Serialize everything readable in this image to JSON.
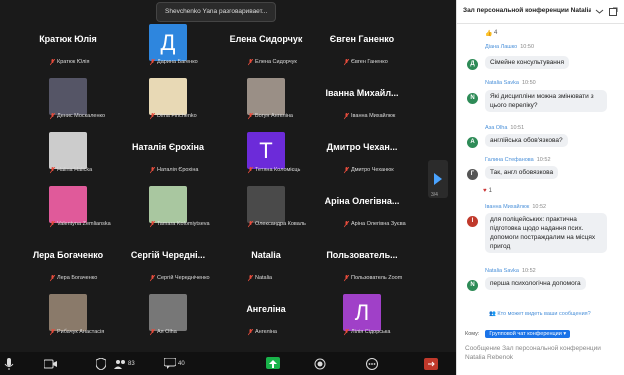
{
  "toast": "Shevchenko Yana разговаривает...",
  "tiles": [
    {
      "kind": "name",
      "big": "Кратюк Юлія",
      "label": "Кратюк Юлія"
    },
    {
      "kind": "letter",
      "letter": "Д",
      "color": "#2e86de",
      "label": "Дарина Багенко"
    },
    {
      "kind": "name",
      "big": "Елена Сидорчук",
      "label": "Елена Сидорчук"
    },
    {
      "kind": "name",
      "big": "Євген Ганенко",
      "label": "Євген Ганенко"
    },
    {
      "kind": "photo",
      "photo": "#556",
      "label": "Денис Москаленко"
    },
    {
      "kind": "photo",
      "photo": "#e8d9b5",
      "label": "Dima Finchenko"
    },
    {
      "kind": "photo",
      "photo": "#9a8f86",
      "label": "Богун Ангеліна"
    },
    {
      "kind": "name",
      "big": "Іванна Михайл...",
      "label": "Іванна Михайлюк"
    },
    {
      "kind": "photo",
      "photo": "#ccc",
      "label": "Halina Halicka"
    },
    {
      "kind": "name",
      "big": "Наталія Єрохіна",
      "label": "Наталія Єрохіна"
    },
    {
      "kind": "letter",
      "letter": "Т",
      "color": "#6c2bd9",
      "label": "Тетяна Коломієць"
    },
    {
      "kind": "name",
      "big": "Дмитро Чехан...",
      "label": "Дмитро Чеханюк"
    },
    {
      "kind": "photo",
      "photo": "#e05a9a",
      "label": "Valentyna Zemlianska"
    },
    {
      "kind": "photo",
      "photo": "#a9c7a0",
      "label": "Tamara Kolomiytseva"
    },
    {
      "kind": "photo",
      "photo": "#4a4a4a",
      "label": "Олександра Коваль"
    },
    {
      "kind": "name",
      "big": "Аріна Олегівна...",
      "label": "Аріна Олегівна Зуєва"
    },
    {
      "kind": "name",
      "big": "Лера Богаченко",
      "label": "Лера Богаченко"
    },
    {
      "kind": "name",
      "big": "Сергій Чередні...",
      "label": "Сергій Чередніченко"
    },
    {
      "kind": "name",
      "big": "Natalia",
      "label": "Natalia"
    },
    {
      "kind": "name",
      "big": "Пользователь...",
      "label": "Пользователь Zoom"
    },
    {
      "kind": "photo",
      "photo": "#8a7a6a",
      "label": "Рибачук Анастасія"
    },
    {
      "kind": "photo",
      "photo": "#777",
      "label": "Ая Olha"
    },
    {
      "kind": "name",
      "big": "Ангеліна",
      "label": "Ангеліна"
    },
    {
      "kind": "letter",
      "letter": "Л",
      "color": "#a040c8",
      "label": "Лілія Сідорська"
    }
  ],
  "page_indicator": "3/4",
  "toolbar": {
    "participants_count": "83",
    "reactions_count": "40"
  },
  "chat": {
    "title": "Зал персональной конференции Natalia R...",
    "first_reaction": "4",
    "messages": [
      {
        "sender": "Діана Лашко",
        "time": "10:50",
        "avatar": "Д",
        "avatar_color": "#2e8b57",
        "text": "Сімейне консультування"
      },
      {
        "sender": "Natalia Savka",
        "time": "10:50",
        "avatar": "N",
        "avatar_color": "#2e8b57",
        "text": "Які дисципліни можна змінювати з цього переліку?"
      },
      {
        "sender": "Аза Olha",
        "time": "10:51",
        "avatar": "А",
        "avatar_color": "#2e8b57",
        "text": "англійська обов'язкова?"
      },
      {
        "sender": "Галина Стефанова",
        "time": "10:52",
        "avatar": "Г",
        "avatar_color": "#555",
        "text": "Так, англ обовязкова",
        "reaction": "1"
      },
      {
        "sender": "Іванна Михайлюк",
        "time": "10:52",
        "avatar": "І",
        "avatar_color": "#c0392b",
        "text": "для поліцейських: практична підготовка щодо надання псих. допомоги постраждалим на місцях пригод"
      },
      {
        "sender": "Natalia Savka",
        "time": "10:52",
        "avatar": "N",
        "avatar_color": "#2e8b57",
        "text": "перша психологічна допомога"
      }
    ],
    "unread": "Кто может видеть ваши сообщения?",
    "to_label": "Кому:",
    "to_value": "Групповой чат конференции",
    "compose_placeholder": "Сообщение Зал персональной конференции Natalia Rebenok"
  }
}
